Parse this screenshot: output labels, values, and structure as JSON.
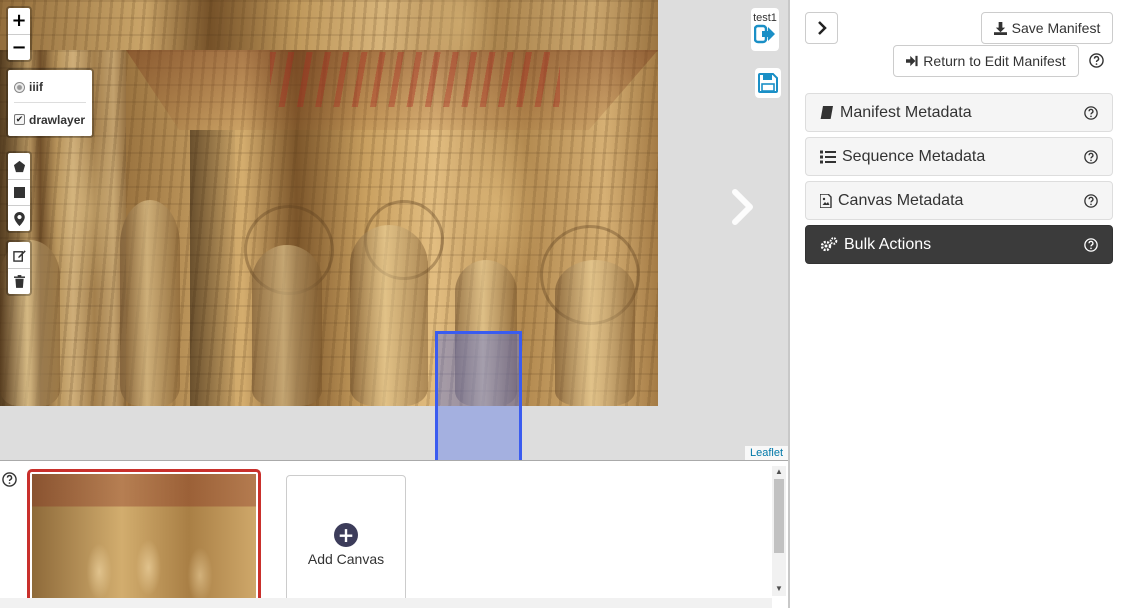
{
  "viewer": {
    "zoom_in": "+",
    "zoom_out": "−",
    "layers": [
      {
        "label": "iiif",
        "type": "radio"
      },
      {
        "label": "drawlayer",
        "type": "checkbox",
        "checked": true
      }
    ],
    "draw_tools": [
      "polygon-icon",
      "rectangle-icon",
      "marker-icon"
    ],
    "edit_tools": [
      "edit-icon",
      "trash-icon"
    ],
    "user_label": "test1",
    "attribution": "Leaflet"
  },
  "strip": {
    "add_canvas_label": "Add Canvas"
  },
  "panel": {
    "save_manifest": "Save Manifest",
    "return_to_edit": "Return to Edit Manifest",
    "sections": [
      {
        "label": "Manifest Metadata",
        "icon": "book-icon"
      },
      {
        "label": "Sequence Metadata",
        "icon": "list-ol-icon"
      },
      {
        "label": "Canvas Metadata",
        "icon": "image-file-icon"
      },
      {
        "label": "Bulk Actions",
        "icon": "cogs-icon",
        "active": true
      }
    ]
  },
  "colors": {
    "accent_blue": "#3a5cf0",
    "selected_thumb_border": "#c9302c",
    "active_section": "#3b3b3b",
    "link_blue": "#0078a8"
  }
}
